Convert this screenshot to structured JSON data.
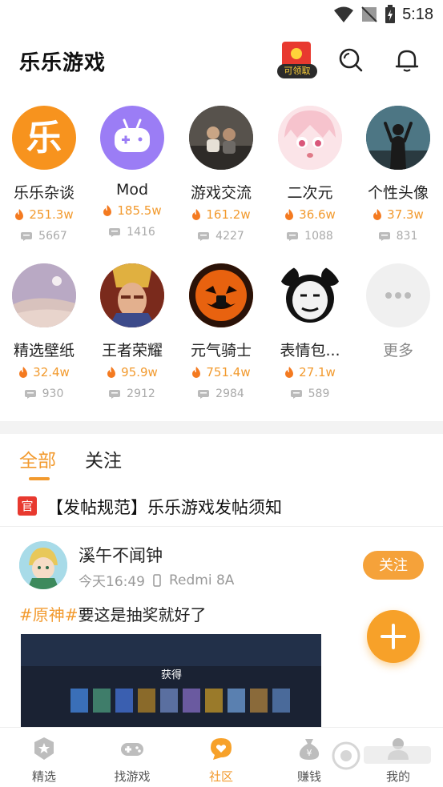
{
  "status_bar": {
    "time": "5:18"
  },
  "header": {
    "app_title": "乐乐游戏",
    "redpack_label": "可领取"
  },
  "categories": [
    {
      "name": "乐乐杂谈",
      "heat": "251.3w",
      "posts": "5667",
      "avatar_color": "#f7931e"
    },
    {
      "name": "Mod",
      "heat": "185.5w",
      "posts": "1416",
      "avatar_color": "#9b7df5"
    },
    {
      "name": "游戏交流",
      "heat": "161.2w",
      "posts": "4227",
      "avatar_color": "#4a4a4a"
    },
    {
      "name": "二次元",
      "heat": "36.6w",
      "posts": "1088",
      "avatar_color": "#f7d6dc"
    },
    {
      "name": "个性头像",
      "heat": "37.3w",
      "posts": "831",
      "avatar_color": "#3c5f6e"
    },
    {
      "name": "精选壁纸",
      "heat": "32.4w",
      "posts": "930",
      "avatar_color": "#c7b6c2"
    },
    {
      "name": "王者荣耀",
      "heat": "95.9w",
      "posts": "2912",
      "avatar_color": "#b53a1f"
    },
    {
      "name": "元气骑士",
      "heat": "751.4w",
      "posts": "2984",
      "avatar_color": "#e8620f"
    },
    {
      "name": "表情包...",
      "heat": "27.1w",
      "posts": "589",
      "avatar_color": "#ffffff"
    }
  ],
  "more_label": "更多",
  "tabs": [
    {
      "label": "全部"
    },
    {
      "label": "关注"
    }
  ],
  "notice": {
    "badge": "官",
    "text": "【发帖规范】乐乐游戏发帖须知"
  },
  "post": {
    "username": "溪午不闻钟",
    "time": "今天16:49",
    "device": "Redmi 8A",
    "follow_label": "关注",
    "topic": "#原神#",
    "text": "要这是抽奖就好了",
    "image_caption": "获得"
  },
  "bottom_nav": [
    {
      "label": "精选"
    },
    {
      "label": "找游戏"
    },
    {
      "label": "社区"
    },
    {
      "label": "赚钱"
    },
    {
      "label": "我的"
    }
  ],
  "colors": {
    "accent": "#f29a2e",
    "official_red": "#e8392f"
  }
}
